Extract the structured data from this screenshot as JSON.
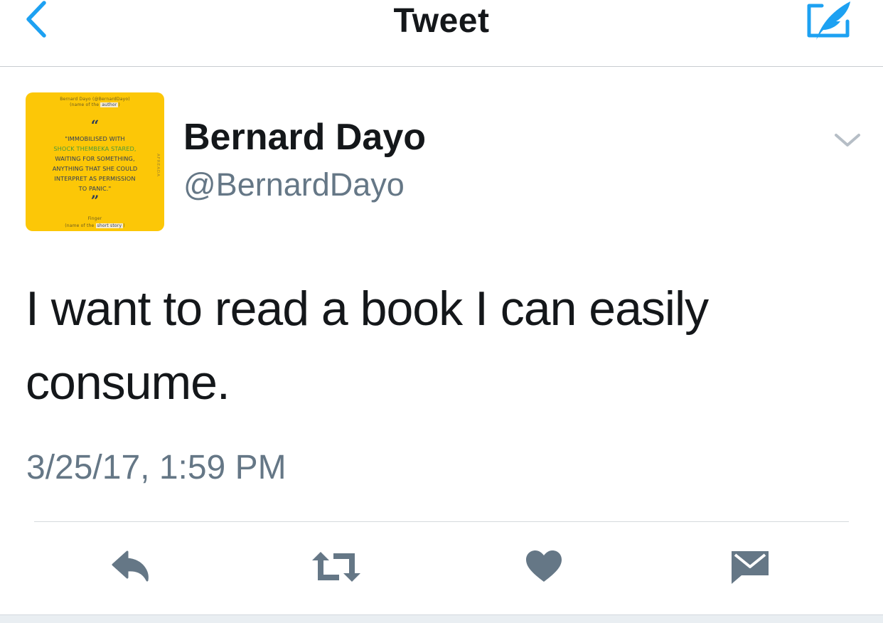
{
  "colors": {
    "accent": "#1da1f2",
    "text": "#14171a",
    "secondary": "#657786",
    "action_icon": "#657786",
    "avatar_bg": "#fcc707"
  },
  "navbar": {
    "title": "Tweet",
    "back_icon": "chevron-left-icon",
    "compose_icon": "compose-tweet-icon"
  },
  "tweet": {
    "author": {
      "display_name": "Bernard Dayo",
      "handle": "@BernardDayo",
      "avatar": {
        "header_line": "Bernard Dayo (@BernardDayo)",
        "header_note_prefix": "(name of the ",
        "header_note_highlight": "author",
        "header_note_suffix": ")",
        "open_quote": "“",
        "quote_lines": [
          "\"IMMOBILISED WITH",
          "SHOCK THEMBEKA STARED,",
          "WAITING FOR SOMETHING,",
          "ANYTHING THAT SHE COULD",
          "INTERPRET AS PERMISSION",
          "TO PANIC.\""
        ],
        "close_quote": "”",
        "footer_line": "Finger",
        "footer_note_prefix": "(name of the ",
        "footer_note_highlight": "short story",
        "footer_note_suffix": ")",
        "side_label": "AFREADA"
      }
    },
    "text": "I want to read a book I can easily consume.",
    "timestamp": "3/25/17, 1:59 PM",
    "menu_icon": "chevron-down-icon"
  },
  "actions": [
    {
      "name": "reply",
      "icon": "reply-icon"
    },
    {
      "name": "retweet",
      "icon": "retweet-icon"
    },
    {
      "name": "like",
      "icon": "heart-icon"
    },
    {
      "name": "direct-message",
      "icon": "envelope-icon"
    }
  ]
}
